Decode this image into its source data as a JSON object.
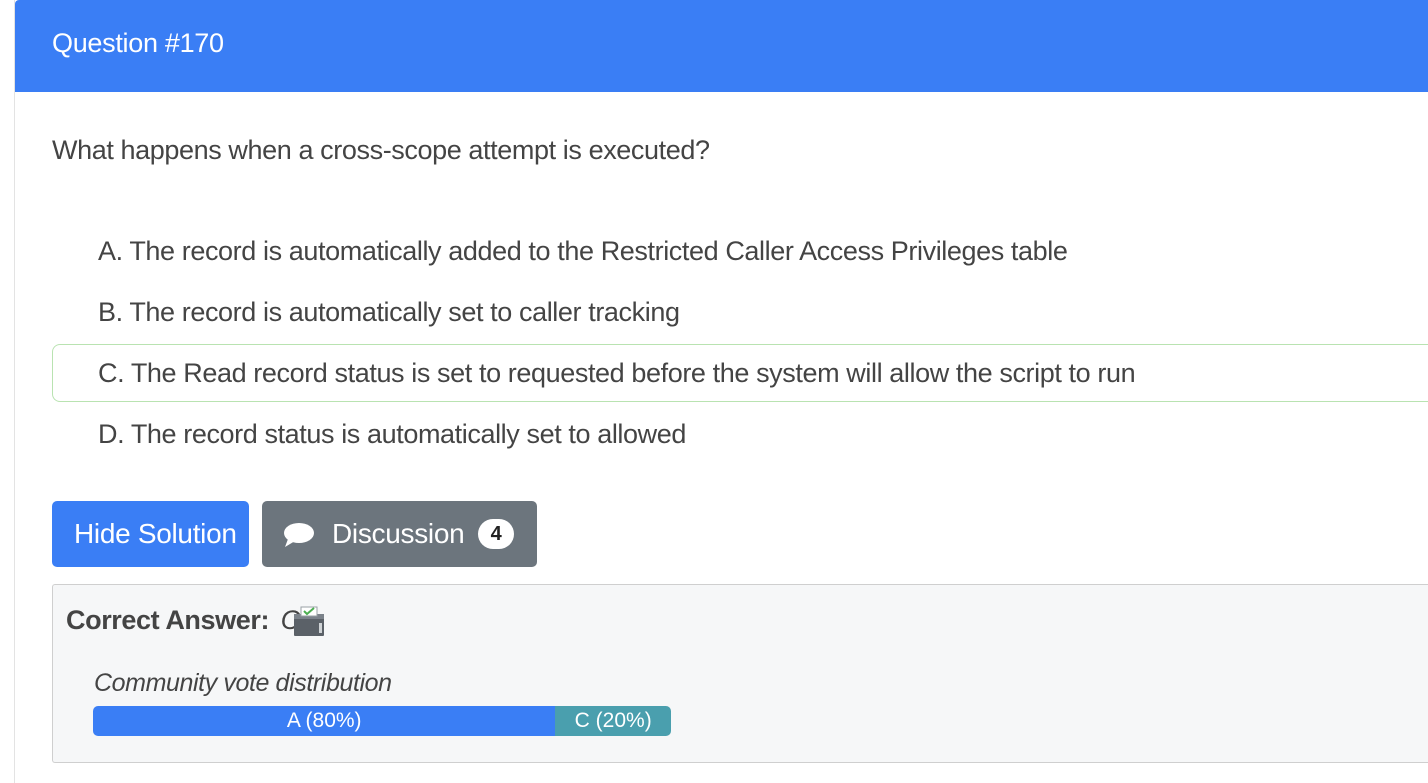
{
  "header": {
    "title": "Question #170",
    "color": "#3a7ef5"
  },
  "question": {
    "text": "What happens when a cross-scope attempt is executed?"
  },
  "choices": [
    {
      "text": "A. The record is automatically added to the Restricted Caller Access Privileges table",
      "correct": false
    },
    {
      "text": "B. The record is automatically set to caller tracking",
      "correct": false
    },
    {
      "text": "C. The Read record status is set to requested before the system will allow the script to run",
      "correct": true
    },
    {
      "text": "D. The record status is automatically set to allowed",
      "correct": false
    }
  ],
  "buttons": {
    "hide_solution": "Hide Solution",
    "discussion": "Discussion",
    "discussion_count": "4",
    "discussion_icon": "chat-bubble-icon"
  },
  "solution": {
    "label": "Correct Answer:",
    "value": "C",
    "icon": "ballot-box-icon",
    "vote_caption": "Community vote distribution",
    "votes": [
      {
        "label": "A (80%)",
        "percent": 80,
        "color": "#3a7ef5"
      },
      {
        "label": "C (20%)",
        "percent": 20,
        "color": "#4a9fae"
      }
    ]
  }
}
